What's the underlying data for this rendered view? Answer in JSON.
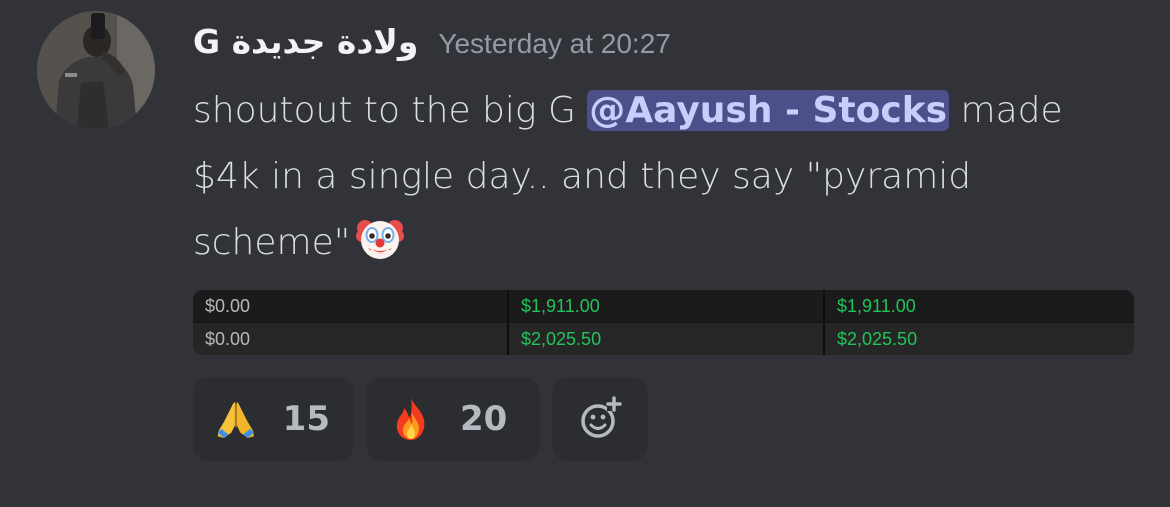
{
  "author": {
    "username": "G ولادة جديدة",
    "timestamp": "Yesterday at 20:27"
  },
  "message": {
    "line1_before": "shoutout to the big G ",
    "mention": "@Aayush - Stocks",
    "line1_after": " made",
    "line2": "$4k in a single day.. and they say \"pyramid",
    "line3": "scheme\"",
    "trailing_emoji": "clown-face"
  },
  "attachment_table": {
    "rows": [
      [
        "$0.00",
        "$1,911.00",
        "$1,911.00"
      ],
      [
        "$0.00",
        "$2,025.50",
        "$2,025.50"
      ]
    ],
    "colors": {
      "zero": "#b8b8b8",
      "positive": "#21c45a"
    }
  },
  "reactions": [
    {
      "emoji": "folded-hands",
      "count": "15"
    },
    {
      "emoji": "fire",
      "count": "20"
    }
  ],
  "add_reaction_icon": "add-reaction-icon",
  "colors": {
    "background": "#313338",
    "mention_bg": "#4c4f8a",
    "mention_text": "#c9cdfb",
    "reaction_bg": "#2b2d31"
  }
}
